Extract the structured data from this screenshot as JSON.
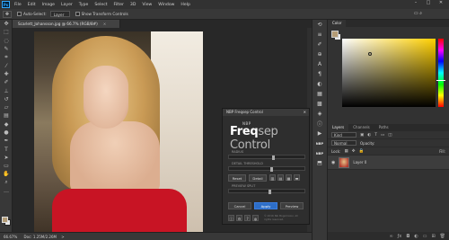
{
  "app": {
    "logo_text": "Ps"
  },
  "menubar": {
    "items": [
      "File",
      "Edit",
      "Image",
      "Layer",
      "Type",
      "Select",
      "Filter",
      "3D",
      "View",
      "Window",
      "Help"
    ],
    "window_buttons": [
      "–",
      "□",
      "✕"
    ]
  },
  "options_bar": {
    "auto_select_label": "Auto-Select:",
    "layer_dropdown": "Layer",
    "show_transform_label": "Show Transform Controls",
    "tool_icon": "move-icon"
  },
  "document": {
    "tab_title": "Scarlett_Johansson.jpg @ 66.7% (RGB/8#)",
    "close": "×"
  },
  "status_bar": {
    "zoom": "66.67%",
    "doc_info": "Doc: 1.25M/2.26M",
    "arrow": ">"
  },
  "right_panels": {
    "color_tab": "Color",
    "layers_tabs": [
      "Layers",
      "Channels",
      "Paths"
    ],
    "layer_kind_label": "Kind",
    "normal_label": "Normal",
    "opacity_label": "Opacity:",
    "lock_label": "Lock:",
    "fill_label": "Fill:",
    "layer_name": "Layer 0",
    "fg_color": "#b49c76",
    "bg_color": "#e8e8e8"
  },
  "plugin": {
    "window_title": "NBP Freqsep Control",
    "brand_small": "NBP",
    "logo_bold": "Freq",
    "logo_thin": "sep Control",
    "radius_label": "RADIUS",
    "detail_label": "DETAIL THRESHOLD",
    "preview_label": "PREVIEW SPLIT",
    "reset_label": "Reset",
    "detail_btn_label": "Detail",
    "cancel_label": "Cancel",
    "apply_label": "Apply",
    "preview_btn_label": "Preview",
    "copyright": "© 2016 Nik Bogomolov. All rights reserved.",
    "accent_color": "#2d6ec8"
  },
  "toolbar": {
    "tools": [
      "move-icon",
      "marquee-icon",
      "lasso-icon",
      "quick-select-icon",
      "crop-icon",
      "eyedropper-icon",
      "healing-icon",
      "brush-icon",
      "stamp-icon",
      "history-brush-icon",
      "eraser-icon",
      "gradient-icon",
      "blur-icon",
      "dodge-icon",
      "pen-icon",
      "type-icon",
      "path-select-icon",
      "shape-icon",
      "hand-icon",
      "zoom-icon",
      "more-icon"
    ]
  }
}
